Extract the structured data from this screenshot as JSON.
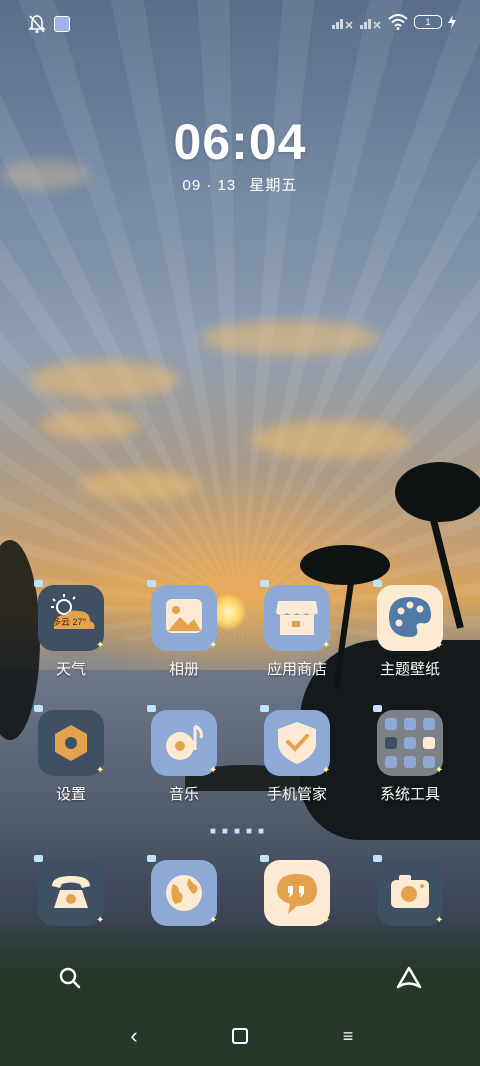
{
  "status_bar": {
    "battery_level": "1",
    "icons": [
      "bell-off-icon",
      "app-notification-icon",
      "signal-icon",
      "signal-icon",
      "wifi-icon",
      "battery-icon",
      "charging-icon"
    ]
  },
  "clock": {
    "time": "06:04",
    "date": "09 · 13",
    "weekday": "星期五"
  },
  "apps_row1": [
    {
      "label": "天气",
      "icon": "weather-icon",
      "badge": "多云 27°"
    },
    {
      "label": "相册",
      "icon": "gallery-icon"
    },
    {
      "label": "应用商店",
      "icon": "app-store-icon"
    },
    {
      "label": "主题壁纸",
      "icon": "palette-icon"
    }
  ],
  "apps_row2": [
    {
      "label": "设置",
      "icon": "settings-icon"
    },
    {
      "label": "音乐",
      "icon": "music-icon"
    },
    {
      "label": "手机管家",
      "icon": "security-icon"
    },
    {
      "label": "系统工具",
      "icon": "folder-icon"
    }
  ],
  "dock": [
    {
      "icon": "phone-icon"
    },
    {
      "icon": "browser-icon"
    },
    {
      "icon": "messages-icon"
    },
    {
      "icon": "camera-icon"
    }
  ],
  "search_bar": {
    "icons": [
      "search-icon",
      "assistant-icon"
    ]
  },
  "nav_bar": {
    "back": "‹",
    "home": "▢",
    "menu": "≡"
  },
  "colors": {
    "icon_blue": "#8fa9d6",
    "icon_dark": "#3f5063",
    "icon_cream": "#fcebd2",
    "accent_orange": "#e3a24c"
  }
}
